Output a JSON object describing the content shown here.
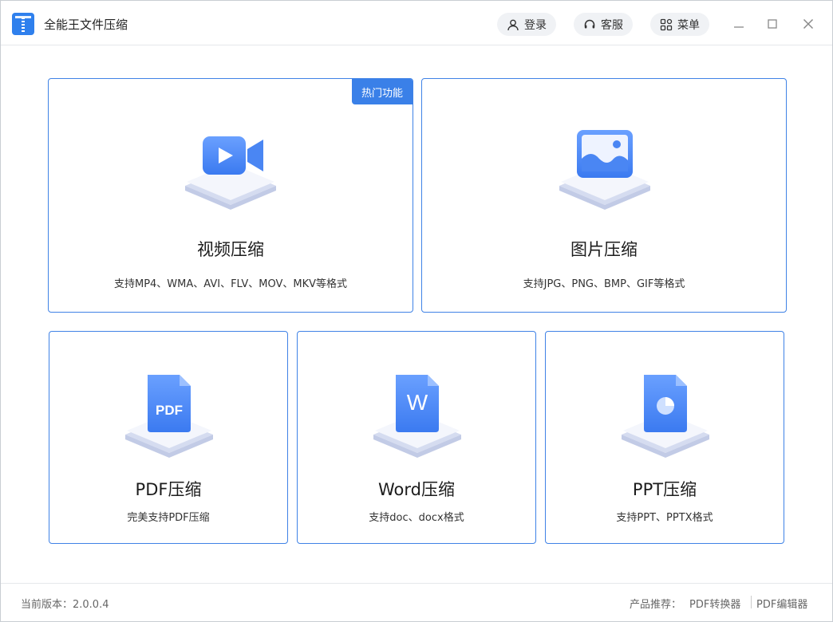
{
  "app": {
    "title": "全能王文件压缩"
  },
  "header": {
    "login_label": "登录",
    "service_label": "客服",
    "menu_label": "菜单"
  },
  "cards": {
    "video": {
      "badge": "热门功能",
      "title": "视频压缩",
      "desc": "支持MP4、WMA、AVI、FLV、MOV、MKV等格式"
    },
    "image": {
      "title": "图片压缩",
      "desc": "支持JPG、PNG、BMP、GIF等格式"
    },
    "pdf": {
      "title": "PDF压缩",
      "desc": "完美支持PDF压缩",
      "icon_text": "PDF"
    },
    "word": {
      "title": "Word压缩",
      "desc": "支持doc、docx格式",
      "icon_text": "W"
    },
    "ppt": {
      "title": "PPT压缩",
      "desc": "支持PPT、PPTX格式"
    }
  },
  "footer": {
    "version": "当前版本：2.0.0.4",
    "recommend_label": "产品推荐：",
    "links": [
      "PDF转换器",
      "PDF编辑器"
    ]
  },
  "colors": {
    "accent": "#3f82e6",
    "icon_blue": "#4d8df5"
  }
}
